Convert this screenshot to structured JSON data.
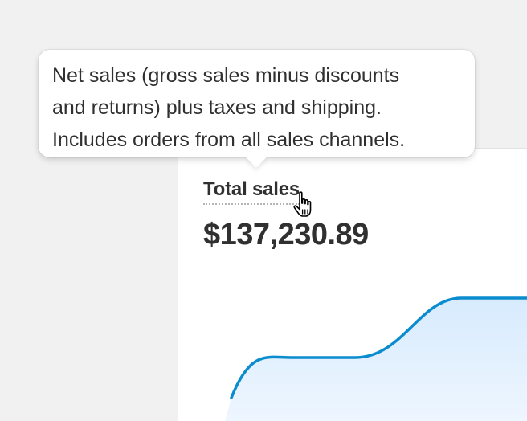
{
  "tooltip": {
    "lines": [
      "Net sales (gross sales minus discounts",
      "and returns) plus taxes and shipping.",
      "Includes orders from all sales channels."
    ]
  },
  "metric": {
    "title": "Total sales",
    "value": "$137,230.89"
  },
  "colors": {
    "background": "#f1f1f1",
    "card": "#ffffff",
    "text": "#303030",
    "line": "#0a8ccf",
    "area": "#dceeff"
  },
  "icons": {
    "cursor": "hand-pointer-icon"
  }
}
